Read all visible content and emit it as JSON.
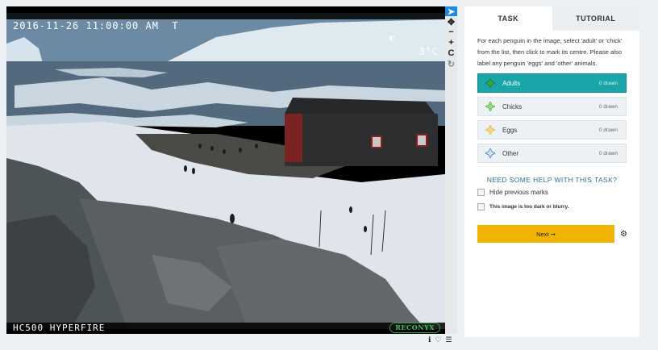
{
  "camera": {
    "timestamp": "2016-11-26 11:00:00 AM  T",
    "moon_icon": "moon-phase-icon",
    "temperature": "3°C",
    "model": "HC500 HYPERFIRE",
    "brand": "RECONYX"
  },
  "tools": [
    {
      "name": "pointer-icon",
      "glyph": "➤"
    },
    {
      "name": "move-icon",
      "glyph": "✥"
    },
    {
      "name": "zoom-out-icon",
      "glyph": "−"
    },
    {
      "name": "zoom-in-icon",
      "glyph": "+"
    },
    {
      "name": "reset-icon",
      "glyph": "C"
    },
    {
      "name": "rotate-icon",
      "glyph": "↻"
    }
  ],
  "meta": {
    "info_icon": "info-icon",
    "favorite_icon": "heart-icon",
    "collect_icon": "list-icon"
  },
  "tabs": {
    "task": "TASK",
    "tutorial": "TUTORIAL"
  },
  "instructions": "For each penguin in the image, select 'adult' or 'chick' from the list, then click to mark its centre. Please also label any penguin 'eggs' and 'other' animals.",
  "choices": [
    {
      "label": "Adults",
      "count": "0 drawn",
      "color": "#39a83c"
    },
    {
      "label": "Chicks",
      "count": "0 drawn",
      "color": "#62cf4a"
    },
    {
      "label": "Eggs",
      "count": "0 drawn",
      "color": "#f0c040"
    },
    {
      "label": "Other",
      "count": "0 drawn",
      "color": "#3a7bd5"
    }
  ],
  "help": "NEED SOME HELP WITH THIS TASK?",
  "hide_marks": "Hide previous marks",
  "too_dark": "This image is too dark or blurry.",
  "next": "Next ➞",
  "colors": {
    "active_choice": "#1aa5a8",
    "next_button": "#f0b400",
    "help_text": "#2b6f9e"
  }
}
